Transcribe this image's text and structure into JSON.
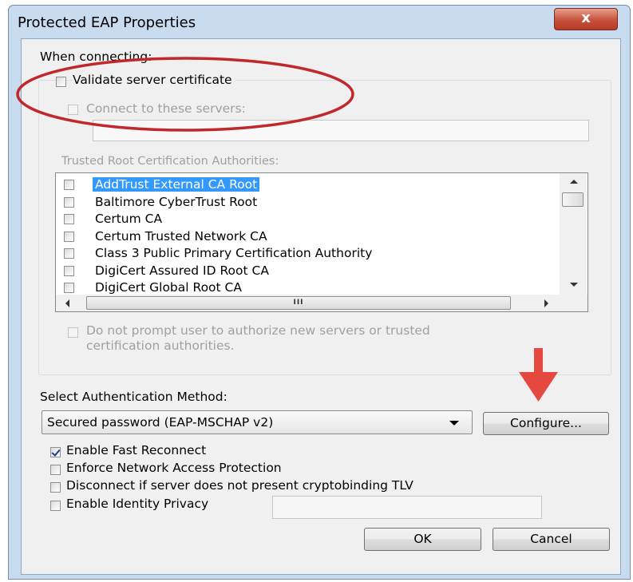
{
  "window": {
    "title": "Protected EAP Properties",
    "close_glyph": "x"
  },
  "connecting": {
    "group_label": "When connecting:",
    "validate_cert_label": "Validate server certificate",
    "validate_cert_checked": false,
    "connect_servers_label": "Connect to these servers:",
    "connect_servers_checked": false,
    "servers_value": "",
    "trusted_root_label": "Trusted Root Certification Authorities:",
    "authorities": [
      {
        "label": "AddTrust External CA Root",
        "checked": false,
        "selected": true
      },
      {
        "label": "Baltimore CyberTrust Root",
        "checked": false,
        "selected": false
      },
      {
        "label": "Certum CA",
        "checked": false,
        "selected": false
      },
      {
        "label": "Certum Trusted Network CA",
        "checked": false,
        "selected": false
      },
      {
        "label": "Class 3 Public Primary Certification Authority",
        "checked": false,
        "selected": false
      },
      {
        "label": "DigiCert Assured ID Root CA",
        "checked": false,
        "selected": false
      },
      {
        "label": "DigiCert Global Root CA",
        "checked": false,
        "selected": false
      }
    ],
    "hscroll_thumb_glyph": "III",
    "do_not_prompt_label_line1": "Do not prompt user to authorize new servers or trusted",
    "do_not_prompt_label_line2": "certification authorities.",
    "do_not_prompt_checked": false
  },
  "auth": {
    "method_label": "Select Authentication Method:",
    "method_value": "Secured password (EAP-MSCHAP v2)",
    "configure_label": "Configure...",
    "options": [
      {
        "label": "Enable Fast Reconnect",
        "checked": true
      },
      {
        "label": "Enforce Network Access Protection",
        "checked": false
      },
      {
        "label": "Disconnect if server does not present cryptobinding TLV",
        "checked": false
      },
      {
        "label": "Enable Identity Privacy",
        "checked": false
      }
    ],
    "identity_value": ""
  },
  "buttons": {
    "ok_label": "OK",
    "cancel_label": "Cancel"
  },
  "annotations": {
    "highlight_color": "#c0282d",
    "arrow_color": "#e5483f"
  }
}
